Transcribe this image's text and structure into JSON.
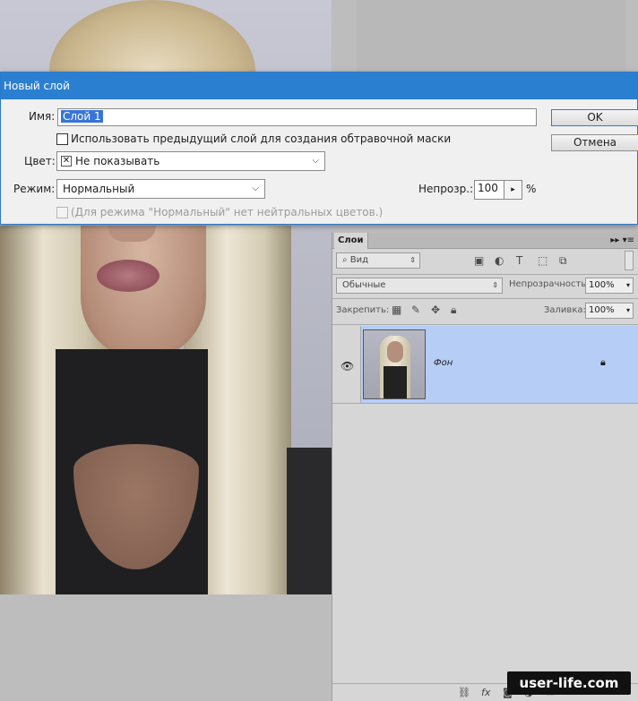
{
  "dialog": {
    "title": "Новый слой",
    "name_label": "Имя:",
    "name_value": "Слой 1",
    "clip_checkbox_label": "Использовать предыдущий слой для создания обтравочной маски",
    "color_label": "Цвет:",
    "color_value": "Не показывать",
    "mode_label": "Режим:",
    "mode_value": "Нормальный",
    "opacity_label": "Непрозр.:",
    "opacity_value": "100",
    "opacity_unit": "%",
    "note": "(Для режима \"Нормальный\" нет нейтральных цветов.)",
    "ok_label": "OK",
    "cancel_label": "Отмена"
  },
  "layers_panel": {
    "tab_label": "Слои",
    "tab_controls": "▸▸ ▾≡",
    "filter_label": "Вид",
    "blend_mode": "Обычные",
    "opacity_label": "Непрозрачность:",
    "opacity_value": "100%",
    "lock_label": "Закрепить:",
    "fill_label": "Заливка:",
    "fill_value": "100%",
    "layers": [
      {
        "name": "Фон",
        "visible": true,
        "locked": true,
        "selected": true
      }
    ]
  },
  "watermark": "user-life.com",
  "colors": {
    "dialog_title_bg": "#2b7fd0",
    "selected_layer_bg": "#b6cdf5",
    "selection_highlight": "#3875d7"
  }
}
